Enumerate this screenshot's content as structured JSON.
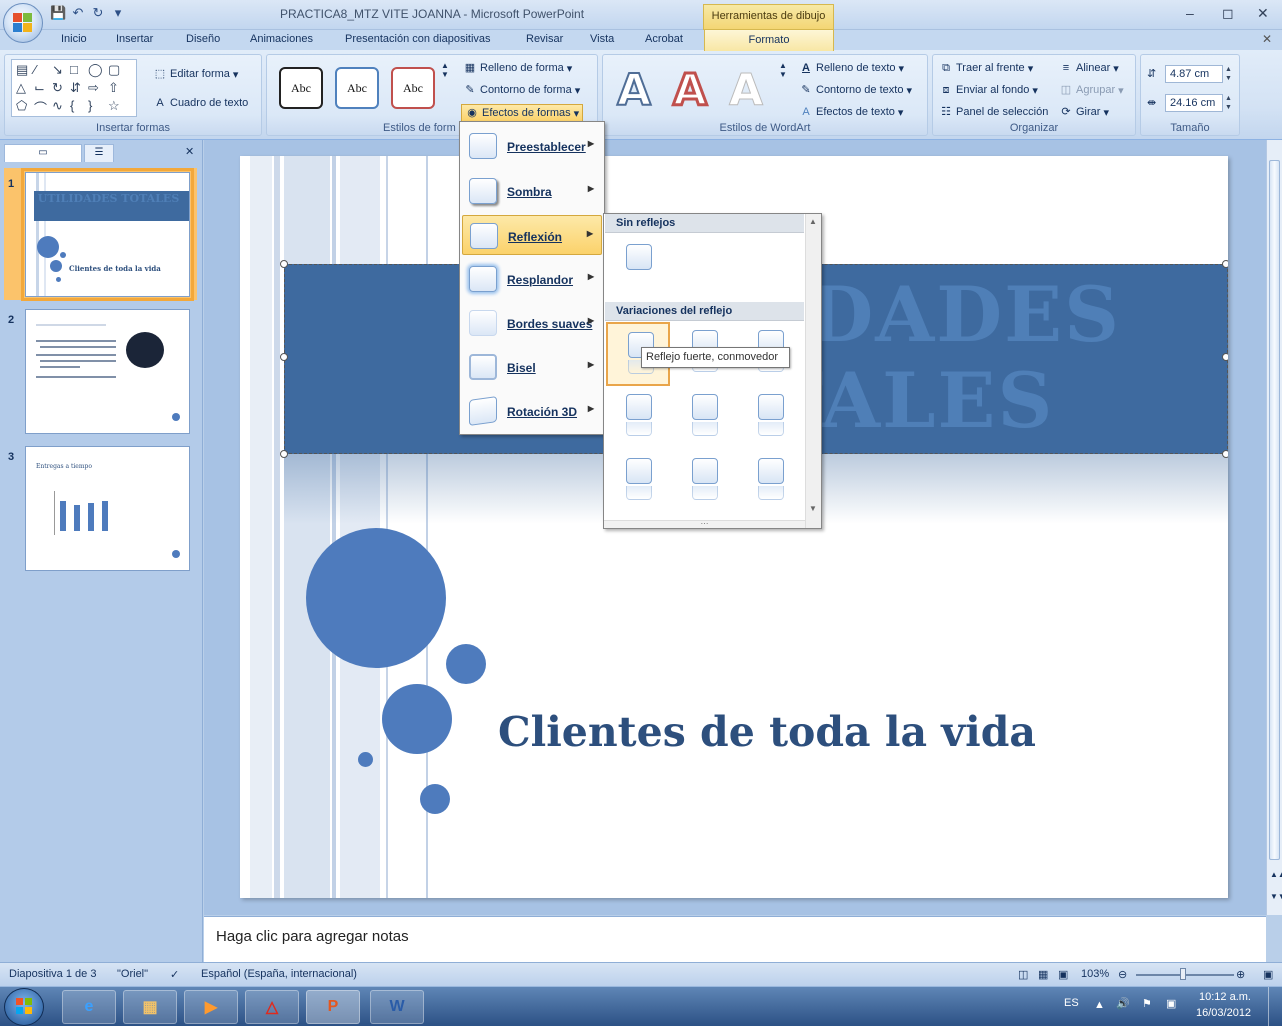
{
  "window": {
    "title": "PRACTICA8_MTZ VITE JOANNA - Microsoft PowerPoint",
    "context_group": "Herramientas de dibujo"
  },
  "tabs": [
    "Inicio",
    "Insertar",
    "Diseño",
    "Animaciones",
    "Presentación con diapositivas",
    "Revisar",
    "Vista",
    "Acrobat",
    "Formato"
  ],
  "ribbon": {
    "insert_shapes": {
      "edit_shape": "Editar forma",
      "text_box": "Cuadro de texto",
      "label": "Insertar formas"
    },
    "shape_styles": {
      "swatch_text": "Abc",
      "label": "Estilos de form",
      "fill": "Relleno de forma",
      "outline": "Contorno de forma",
      "effects": "Efectos de formas"
    },
    "wordart": {
      "letter": "A",
      "text_fill": "Relleno de texto",
      "text_outline": "Contorno de texto",
      "text_effects": "Efectos de texto",
      "label": "Estilos de WordArt"
    },
    "arrange": {
      "bring_front": "Traer al frente",
      "send_back": "Enviar al fondo",
      "selection_pane": "Panel de selección",
      "align": "Alinear",
      "group": "Agrupar",
      "rotate": "Girar",
      "label": "Organizar"
    },
    "size": {
      "height": "4.87 cm",
      "width": "24.16 cm",
      "label": "Tamaño"
    }
  },
  "effects_menu": {
    "items": [
      "Preestablecer",
      "Sombra",
      "Reflexión",
      "Resplandor",
      "Bordes suaves",
      "Bisel",
      "Rotación 3D"
    ],
    "active": "Reflexión"
  },
  "reflection_submenu": {
    "no_reflection_header": "Sin reflejos",
    "variations_header": "Variaciones del reflejo",
    "tooltip": "Reflejo fuerte, conmovedor"
  },
  "slides": [
    {
      "number": "1",
      "title": "UTILIDADES TOTALES",
      "subtitle": "Clientes de toda la vida"
    },
    {
      "number": "2"
    },
    {
      "number": "3",
      "title": "Entregas a tiempo"
    }
  ],
  "slide": {
    "title_line1": "UTILIDADES",
    "title_line2": "TOTALES",
    "subtitle": "Clientes de toda la vida"
  },
  "notes": {
    "placeholder": "Haga clic para agregar notas"
  },
  "status": {
    "slide_info": "Diapositiva 1 de 3",
    "theme": "\"Oriel\"",
    "language": "Español (España, internacional)",
    "zoom": "103%"
  },
  "tray": {
    "lang": "ES",
    "time": "10:12 a.m.",
    "date": "16/03/2012"
  },
  "colors": {
    "band": "#3e6a9f",
    "accent": "#4e7bbd",
    "menu_highlight": "#fbd26b"
  }
}
